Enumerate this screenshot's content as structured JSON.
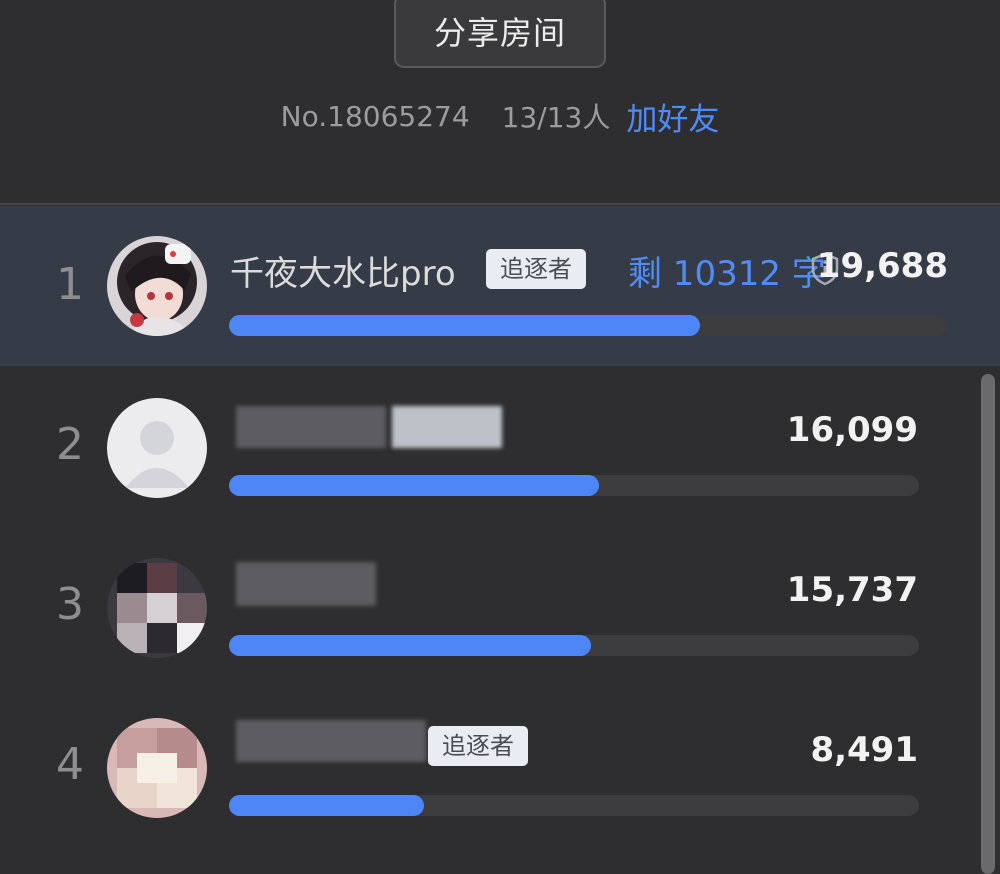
{
  "header": {
    "share_button": "分享房间",
    "room_no": "No.18065274",
    "member_count": "13/13人",
    "add_friend": "加好友"
  },
  "ranking": [
    {
      "rank": "1",
      "name": "千夜大水比pro",
      "badge": "追逐者",
      "remaining": "剩 10312 字",
      "score": "19,688",
      "progress": 0.655,
      "is_current_user": true
    },
    {
      "rank": "2",
      "name": "",
      "badge": "",
      "score": "16,099",
      "progress": 0.536,
      "is_current_user": false
    },
    {
      "rank": "3",
      "name": "",
      "badge": "",
      "score": "15,737",
      "progress": 0.524,
      "is_current_user": false
    },
    {
      "rank": "4",
      "name": "",
      "badge": "追逐者",
      "score": "8,491",
      "progress": 0.282,
      "is_current_user": false
    }
  ],
  "colors": {
    "accent": "#4f86f7",
    "link": "#4f8dff",
    "background": "#2e2e30",
    "highlight_row": "#353b47"
  },
  "icons": {
    "shield": "shield-info-icon"
  }
}
